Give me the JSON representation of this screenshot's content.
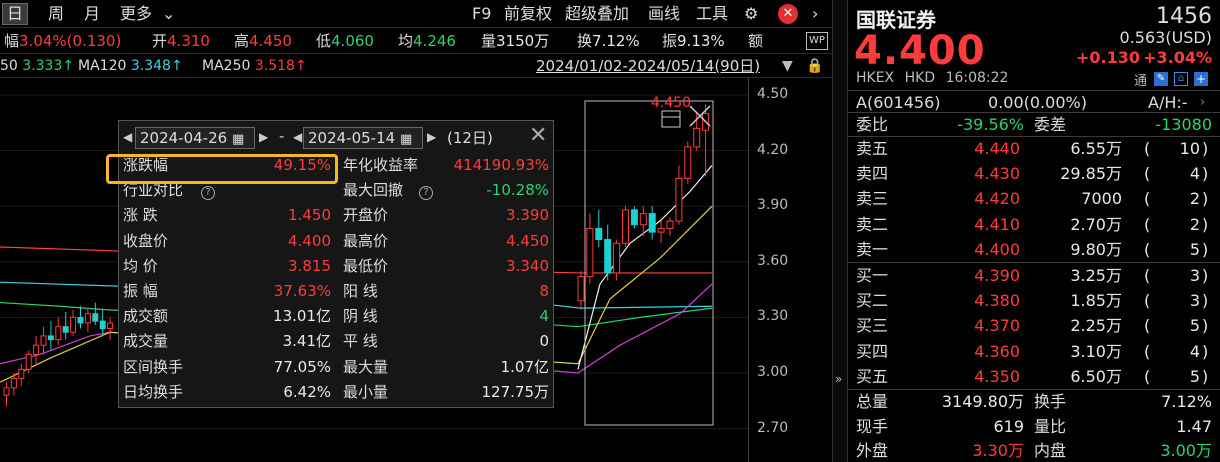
{
  "toolbar": {
    "items": [
      "日",
      "周",
      "月",
      "更多"
    ],
    "right_items": [
      "F9",
      "前复权",
      "超级叠加",
      "画线",
      "工具"
    ]
  },
  "quote_bar": {
    "items": [
      {
        "label": "幅",
        "value": "3.04%(0.130)",
        "color": "red"
      },
      {
        "label": "开",
        "value": "4.310",
        "color": "red"
      },
      {
        "label": "高",
        "value": "4.450",
        "color": "red"
      },
      {
        "label": "低",
        "value": "4.060",
        "color": "green"
      },
      {
        "label": "均",
        "value": "4.246",
        "color": "green"
      },
      {
        "label": "量",
        "value": "3150万",
        "color": "white"
      },
      {
        "label": "换",
        "value": "7.12%",
        "color": "white"
      },
      {
        "label": "振",
        "value": "9.13%",
        "color": "white"
      },
      {
        "label": "额",
        "value": "",
        "color": "white"
      }
    ],
    "wp_badge": "WP"
  },
  "ma_bar": {
    "items": [
      {
        "label": "50",
        "value": "3.333",
        "arrow": "↑",
        "color": "green"
      },
      {
        "label": "MA120",
        "value": "3.348",
        "arrow": "↑",
        "color": "cyan"
      },
      {
        "label": "MA250",
        "value": "3.518",
        "arrow": "↑",
        "color": "red"
      }
    ],
    "date_range": "2024/01/02-2024/05/14(90日)"
  },
  "y_axis": {
    "labels": [
      "4.50",
      "4.20",
      "3.90",
      "3.60",
      "3.30",
      "3.00",
      "2.70"
    ]
  },
  "chart_marks": {
    "high_label": "4.450"
  },
  "popup": {
    "start_date": "2024-04-26",
    "dash": "-",
    "end_date": "2024-05-14",
    "days": "(12日)",
    "rows": [
      {
        "l1": "涨跌幅",
        "v1": "49.15%",
        "c1": "red",
        "l2": "年化收益率",
        "v2": "414190.93%",
        "c2": "red"
      },
      {
        "l1": "行业对比",
        "v1": "",
        "c1": "white",
        "l2": "最大回撤",
        "v2": "-10.28%",
        "c2": "green"
      },
      {
        "l1": "涨  跌",
        "v1": "1.450",
        "c1": "red",
        "l2": "开盘价",
        "v2": "3.390",
        "c2": "red"
      },
      {
        "l1": "收盘价",
        "v1": "4.400",
        "c1": "red",
        "l2": "最高价",
        "v2": "4.450",
        "c2": "red"
      },
      {
        "l1": "均  价",
        "v1": "3.815",
        "c1": "red",
        "l2": "最低价",
        "v2": "3.340",
        "c2": "red"
      },
      {
        "l1": "振  幅",
        "v1": "37.63%",
        "c1": "red",
        "l2": "阳  线",
        "v2": "8",
        "c2": "red"
      },
      {
        "l1": "成交额",
        "v1": "13.01亿",
        "c1": "white",
        "l2": "阴  线",
        "v2": "4",
        "c2": "green"
      },
      {
        "l1": "成交量",
        "v1": "3.41亿",
        "c1": "white",
        "l2": "平  线",
        "v2": "0",
        "c2": "white"
      },
      {
        "l1": "区间换手",
        "v1": "77.05%",
        "c1": "white",
        "l2": "最大量",
        "v2": "1.07亿",
        "c2": "white"
      },
      {
        "l1": "日均换手",
        "v1": "6.42%",
        "c1": "white",
        "l2": "最小量",
        "v2": "127.75万",
        "c2": "white"
      }
    ]
  },
  "stock": {
    "name": "国联证券",
    "code": "1456",
    "usd_price": "0.563(USD)",
    "price": "4.400",
    "change": "+0.130",
    "change_pct": "+3.04%",
    "exchange": "HKEX",
    "currency": "HKD",
    "time": "16:08:22",
    "tong": "通",
    "a_share": "A(601456)",
    "a_value": "0.00(0.00%)",
    "ah": "A/H:-",
    "weibi_label": "委比",
    "weibi": "-39.56%",
    "weicha_label": "委差",
    "weicha": "-13080"
  },
  "asks": [
    {
      "label": "卖五",
      "price": "4.440",
      "vol": "6.55万",
      "count": "10"
    },
    {
      "label": "卖四",
      "price": "4.430",
      "vol": "29.85万",
      "count": "4"
    },
    {
      "label": "卖三",
      "price": "4.420",
      "vol": "7000",
      "count": "2"
    },
    {
      "label": "卖二",
      "price": "4.410",
      "vol": "2.70万",
      "count": "2"
    },
    {
      "label": "卖一",
      "price": "4.400",
      "vol": "9.80万",
      "count": "5"
    }
  ],
  "bids": [
    {
      "label": "买一",
      "price": "4.390",
      "vol": "3.25万",
      "count": "3"
    },
    {
      "label": "买二",
      "price": "4.380",
      "vol": "1.85万",
      "count": "3"
    },
    {
      "label": "买三",
      "price": "4.370",
      "vol": "2.25万",
      "count": "5"
    },
    {
      "label": "买四",
      "price": "4.360",
      "vol": "3.10万",
      "count": "4"
    },
    {
      "label": "买五",
      "price": "4.350",
      "vol": "6.50万",
      "count": "5"
    }
  ],
  "stats": [
    {
      "l1": "总量",
      "v1": "3149.80万",
      "c1": "white",
      "l2": "换手",
      "v2": "7.12%",
      "c2": "white"
    },
    {
      "l1": "现手",
      "v1": "619",
      "c1": "white",
      "l2": "量比",
      "v2": "1.47",
      "c2": "white"
    },
    {
      "l1": "外盘",
      "v1": "3.30万",
      "c1": "red",
      "l2": "内盘",
      "v2": "3.00万",
      "c2": "green"
    }
  ],
  "candles": [
    {
      "o": 2.88,
      "h": 2.95,
      "l": 2.82,
      "c": 2.92
    },
    {
      "o": 2.92,
      "h": 3.0,
      "l": 2.88,
      "c": 2.97
    },
    {
      "o": 2.97,
      "h": 3.05,
      "l": 2.93,
      "c": 3.02
    },
    {
      "o": 3.02,
      "h": 3.12,
      "l": 3.0,
      "c": 3.1
    },
    {
      "o": 3.1,
      "h": 3.2,
      "l": 3.05,
      "c": 3.15
    },
    {
      "o": 3.15,
      "h": 3.25,
      "l": 3.1,
      "c": 3.2
    },
    {
      "o": 3.2,
      "h": 3.28,
      "l": 3.12,
      "c": 3.18
    },
    {
      "o": 3.18,
      "h": 3.3,
      "l": 3.15,
      "c": 3.25
    },
    {
      "o": 3.25,
      "h": 3.33,
      "l": 3.18,
      "c": 3.22
    },
    {
      "o": 3.22,
      "h": 3.34,
      "l": 3.2,
      "c": 3.3
    },
    {
      "o": 3.3,
      "h": 3.36,
      "l": 3.24,
      "c": 3.27
    },
    {
      "o": 3.27,
      "h": 3.35,
      "l": 3.22,
      "c": 3.32
    },
    {
      "o": 3.32,
      "h": 3.38,
      "l": 3.26,
      "c": 3.28
    },
    {
      "o": 3.28,
      "h": 3.34,
      "l": 3.2,
      "c": 3.24
    },
    {
      "o": 3.24,
      "h": 3.3,
      "l": 3.18,
      "c": 3.27
    }
  ],
  "candles_right": [
    {
      "o": 3.39,
      "h": 3.55,
      "l": 3.34,
      "c": 3.52
    },
    {
      "o": 3.52,
      "h": 3.86,
      "l": 3.48,
      "c": 3.78
    },
    {
      "o": 3.78,
      "h": 3.88,
      "l": 3.68,
      "c": 3.72
    },
    {
      "o": 3.72,
      "h": 3.8,
      "l": 3.5,
      "c": 3.54
    },
    {
      "o": 3.54,
      "h": 3.72,
      "l": 3.5,
      "c": 3.7
    },
    {
      "o": 3.7,
      "h": 3.9,
      "l": 3.68,
      "c": 3.88
    },
    {
      "o": 3.88,
      "h": 3.9,
      "l": 3.78,
      "c": 3.8
    },
    {
      "o": 3.8,
      "h": 3.9,
      "l": 3.74,
      "c": 3.86
    },
    {
      "o": 3.86,
      "h": 3.9,
      "l": 3.72,
      "c": 3.76
    },
    {
      "o": 3.76,
      "h": 3.82,
      "l": 3.7,
      "c": 3.78
    },
    {
      "o": 3.78,
      "h": 3.84,
      "l": 3.74,
      "c": 3.82
    },
    {
      "o": 3.82,
      "h": 4.12,
      "l": 3.8,
      "c": 4.05
    },
    {
      "o": 4.05,
      "h": 4.25,
      "l": 4.02,
      "c": 4.22
    },
    {
      "o": 4.22,
      "h": 4.4,
      "l": 4.2,
      "c": 4.32
    },
    {
      "o": 4.31,
      "h": 4.45,
      "l": 4.06,
      "c": 4.4
    }
  ]
}
